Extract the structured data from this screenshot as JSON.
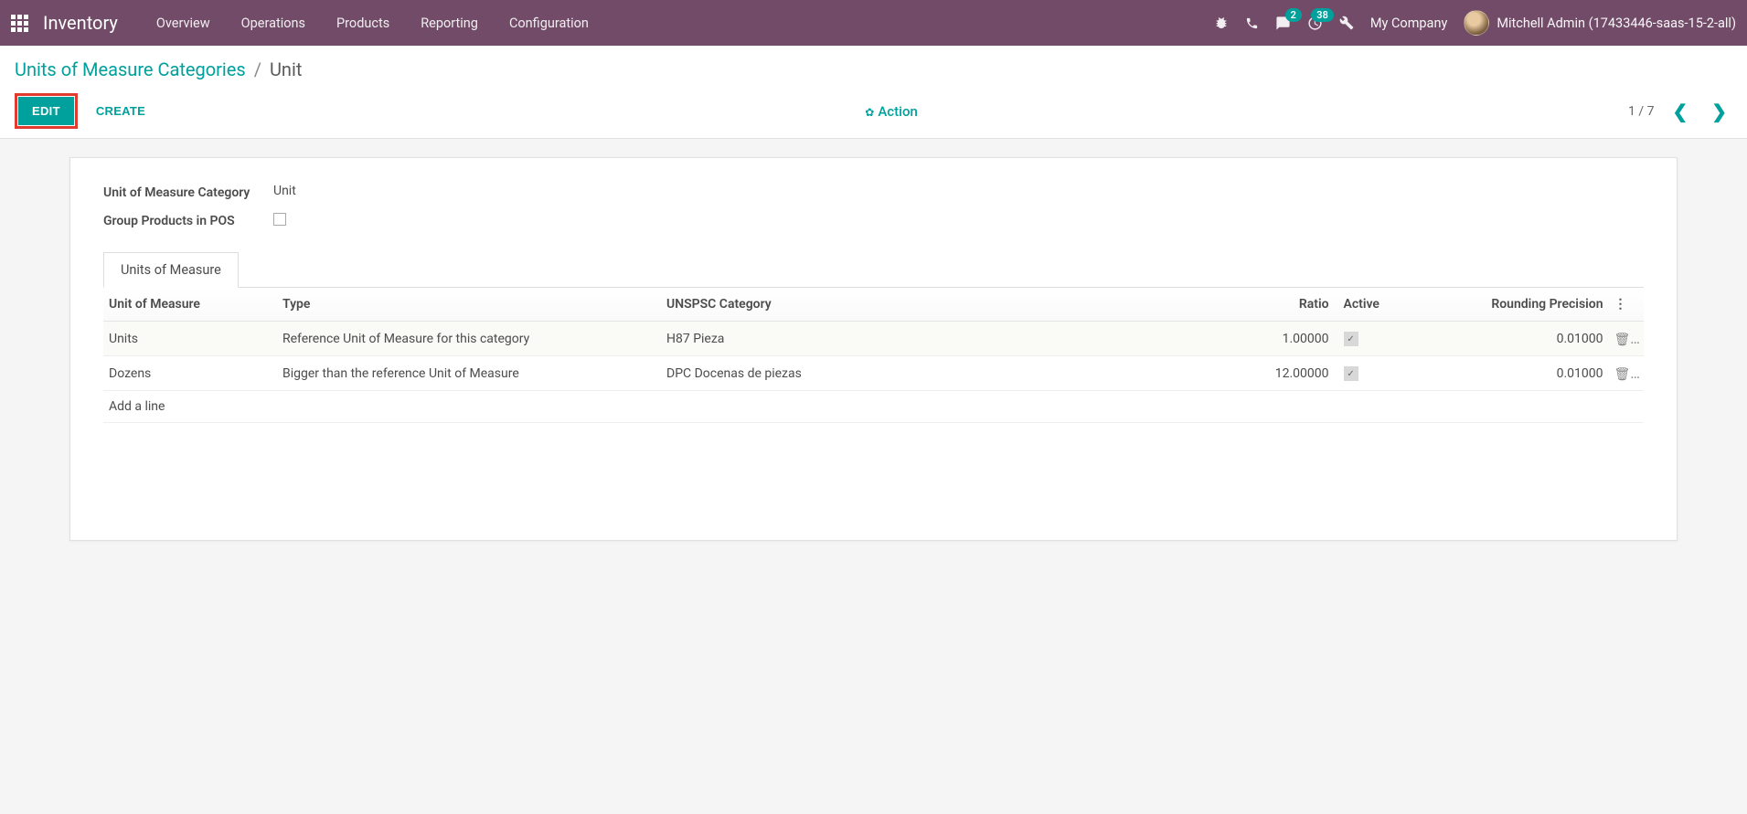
{
  "navbar": {
    "brand": "Inventory",
    "menu": [
      "Overview",
      "Operations",
      "Products",
      "Reporting",
      "Configuration"
    ],
    "messages_badge": "2",
    "activities_badge": "38",
    "company": "My Company",
    "user": "Mitchell Admin (17433446-saas-15-2-all)"
  },
  "breadcrumb": {
    "parent": "Units of Measure Categories",
    "current": "Unit"
  },
  "controls": {
    "edit": "EDIT",
    "create": "CREATE",
    "action": "Action",
    "pager": "1 / 7"
  },
  "form": {
    "category_label": "Unit of Measure Category",
    "category_value": "Unit",
    "group_pos_label": "Group Products in POS",
    "group_pos_checked": false,
    "tab_label": "Units of Measure",
    "columns": {
      "uom": "Unit of Measure",
      "type": "Type",
      "unspsc": "UNSPSC Category",
      "ratio": "Ratio",
      "active": "Active",
      "rounding": "Rounding Precision"
    },
    "rows": [
      {
        "uom": "Units",
        "type": "Reference Unit of Measure for this category",
        "unspsc": "H87 Pieza",
        "ratio": "1.00000",
        "active": true,
        "rounding": "0.01000"
      },
      {
        "uom": "Dozens",
        "type": "Bigger than the reference Unit of Measure",
        "unspsc": "DPC Docenas de piezas",
        "ratio": "12.00000",
        "active": true,
        "rounding": "0.01000"
      }
    ],
    "add_line": "Add a line"
  }
}
